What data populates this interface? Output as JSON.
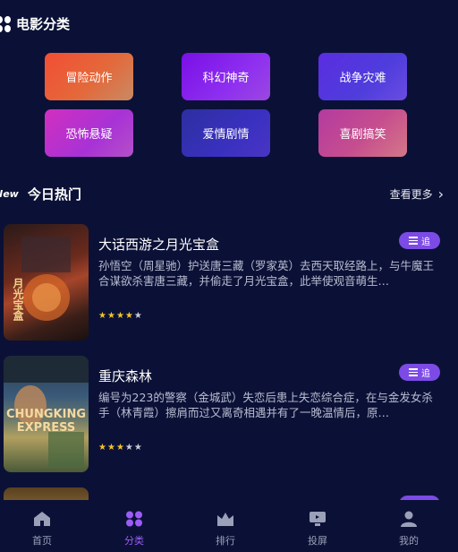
{
  "categories_section": {
    "title": "电影分类",
    "icon": "grid-icon"
  },
  "categories": [
    {
      "label": "冒险动作",
      "color": "#f24e34"
    },
    {
      "label": "科幻神奇",
      "color": "#7a0fe6"
    },
    {
      "label": "战争灾难",
      "color": "#5a2de0"
    },
    {
      "label": "恐怖悬疑",
      "color": "#d12fbf"
    },
    {
      "label": "爱情剧情",
      "color": "#2d2fa0"
    },
    {
      "label": "喜剧搞笑",
      "color": "#b43aa0"
    }
  ],
  "hot_section": {
    "title": "今日热门",
    "badge": "New",
    "more_label": "查看更多"
  },
  "movies": [
    {
      "title": "大话西游之月光宝盒",
      "description": "孙悟空（周星驰）护送唐三藏（罗家英）去西天取经路上，与牛魔王合谋欲杀害唐三藏，并偷走了月光宝盒，此举使观音萌生…",
      "rating": 4,
      "action_label": "追",
      "poster_text": "月光宝盒"
    },
    {
      "title": "重庆森林",
      "description": "编号为223的警察（金城武）失恋后患上失恋综合症，在与金发女杀手（林青霞）擦肩而过又离奇相遇并有了一晚温情后，原…",
      "rating": 3,
      "action_label": "追",
      "poster_text": "CHUNGKING EXPRESS"
    }
  ],
  "tabbar": [
    {
      "label": "首页",
      "icon": "home-icon"
    },
    {
      "label": "分类",
      "icon": "category-icon",
      "active": true
    },
    {
      "label": "排行",
      "icon": "crown-icon"
    },
    {
      "label": "投屏",
      "icon": "cast-icon"
    },
    {
      "label": "我的",
      "icon": "user-icon"
    }
  ],
  "colors": {
    "background": "#0b1136",
    "accent": "#9b5cf6",
    "star": "#f3c22b",
    "button": "#7c4be6"
  }
}
